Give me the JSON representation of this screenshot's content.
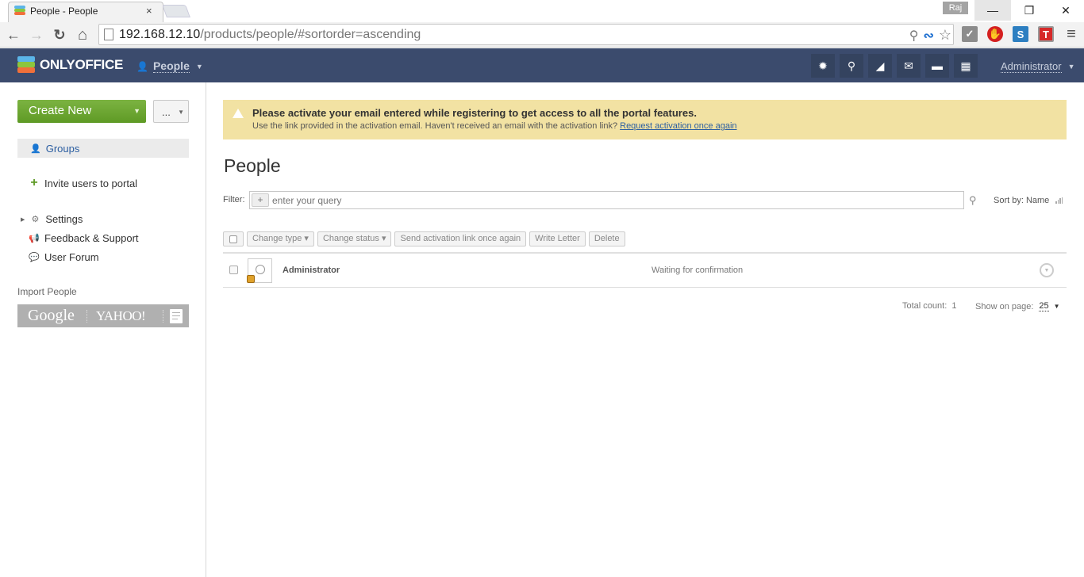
{
  "browser": {
    "tab_title": "People - People",
    "tab_close": "×",
    "user_badge": "Raj",
    "window_controls": {
      "minimize": "—",
      "restore": "❐",
      "close": "✕"
    },
    "nav": {
      "back": "←",
      "forward": "→",
      "reload": "↻",
      "home": "⌂"
    },
    "url_host": "192.168.12.10",
    "url_path": "/products/people/#sortorder=ascending",
    "omnibox_icons": {
      "zoom": "⚲",
      "ext_wave": "∾",
      "star": "☆"
    },
    "extensions": [
      {
        "name": "check-extension",
        "glyph": "✓",
        "color": "#8c8c8c"
      },
      {
        "name": "adblock-extension",
        "glyph": "✋",
        "color": "#d42020"
      },
      {
        "name": "s-extension",
        "glyph": "S",
        "color": "#2d7fc1"
      },
      {
        "name": "t-extension",
        "glyph": "T",
        "color": "#d62828"
      }
    ],
    "menu_glyph": "≡"
  },
  "header": {
    "logo": "ONLYOFFICE",
    "module": "People",
    "icons": [
      "gear-icon",
      "search-icon",
      "feed-icon",
      "mail-icon",
      "chat-icon",
      "calendar-icon"
    ],
    "icon_glyphs": [
      "✹",
      "⚲",
      "◢",
      "✉",
      "▬",
      "▦"
    ],
    "user": "Administrator"
  },
  "sidebar": {
    "create_new": "Create New",
    "more": "...",
    "groups": "Groups",
    "invite": "Invite users to portal",
    "settings": "Settings",
    "feedback": "Feedback & Support",
    "forum": "User Forum",
    "import_title": "Import People",
    "import_google": "Google",
    "import_yahoo": "YAHOO!"
  },
  "notice": {
    "title": "Please activate your email entered while registering to get access to all the portal features.",
    "text": "Use the link provided in the activation email. Haven't received an email with the activation link?",
    "link": "Request activation once again",
    "bg_color": "#f2e2a3"
  },
  "main": {
    "title": "People",
    "filter_label": "Filter:",
    "filter_placeholder": "enter your query",
    "sort_by": "Sort by: Name",
    "actions": [
      "Change type ▾",
      "Change status ▾",
      "Send activation link once again",
      "Write Letter",
      "Delete"
    ],
    "rows": [
      {
        "name": "Administrator",
        "status": "Waiting for confirmation"
      }
    ],
    "total_count_label": "Total count:",
    "total_count": "1",
    "show_on_page_label": "Show on page:",
    "show_on_page": "25"
  }
}
